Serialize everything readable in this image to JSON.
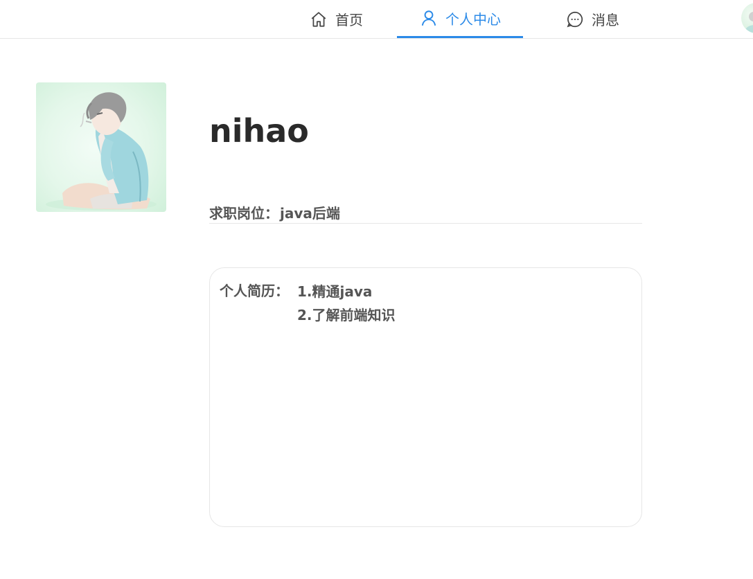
{
  "nav": {
    "items": [
      {
        "label": "首页",
        "icon": "home-icon"
      },
      {
        "label": "个人中心",
        "icon": "user-icon",
        "active": true
      },
      {
        "label": "消息",
        "icon": "message-icon"
      }
    ],
    "active_color": "#2b8ae8"
  },
  "profile": {
    "username": "nihao",
    "job_label": "求职岗位：",
    "job_value": "java后端",
    "resume_label": "个人简历：",
    "resume_lines": [
      "1.精通java",
      "2.了解前端知识"
    ]
  }
}
